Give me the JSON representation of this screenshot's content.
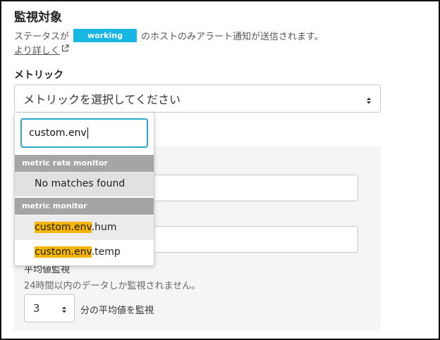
{
  "section": {
    "title": "監視対象",
    "desc_before": "ステータスが",
    "badge": "working",
    "desc_after": "のホストのみアラート通知が送信されます。",
    "more_link": "より詳しく"
  },
  "metric": {
    "label": "メトリック",
    "placeholder": "メトリックを選択してください"
  },
  "dropdown": {
    "search_value": "custom.env",
    "groups": [
      {
        "header": "metric rate monitor",
        "no_matches": "No matches found"
      },
      {
        "header": "metric monitor"
      }
    ],
    "options": [
      {
        "match": "custom.env",
        "rest": ".hum"
      },
      {
        "match": "custom.env",
        "rest": ".temp"
      }
    ]
  },
  "average": {
    "label": "平均値監視",
    "note": "24時間以内のデータしか監視されません。",
    "minutes_value": "3",
    "suffix": "分の平均値を監視"
  },
  "colors": {
    "badge": "#17b6e3",
    "highlight": "#f5b400",
    "focus_border": "#2aa7c9",
    "group_header": "#a5a5a5"
  }
}
